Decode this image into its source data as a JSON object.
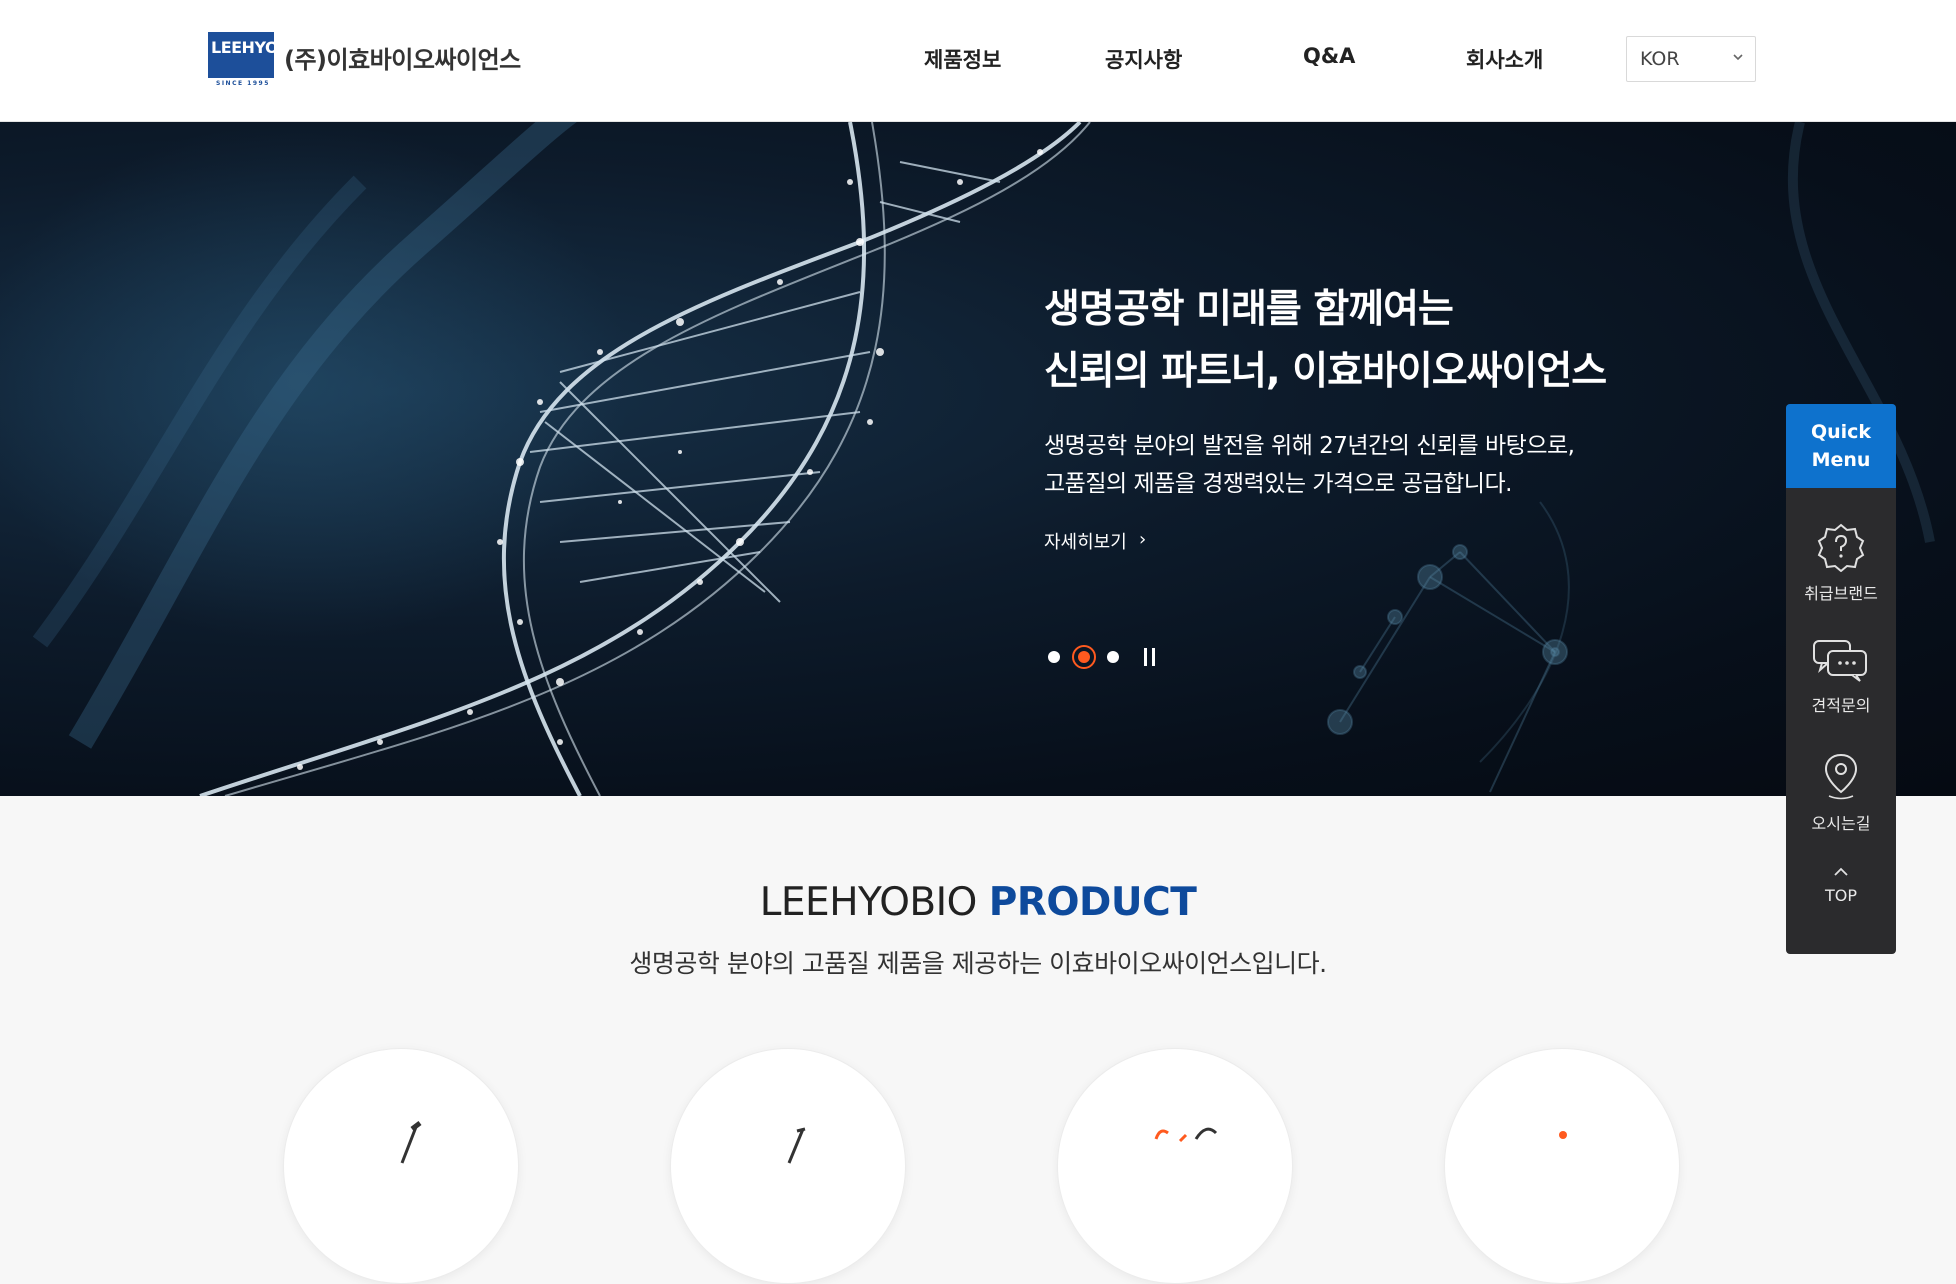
{
  "header": {
    "logo_text": "LEEHYO",
    "logo_since": "SINCE 1995",
    "company_name": "(주)이효바이오싸이언스",
    "nav": [
      "제품정보",
      "공지사항",
      "Q&A",
      "회사소개"
    ],
    "language": {
      "selected": "KOR"
    }
  },
  "hero": {
    "title_line1": "생명공학 미래를 함께여는",
    "title_line2": "신뢰의 파트너, 이효바이오싸이언스",
    "sub_line1": "생명공학 분야의 발전을 위해 27년간의 신뢰를 바탕으로,",
    "sub_line2": "고품질의 제품을 경쟁력있는 가격으로 공급합니다.",
    "more_label": "자세히보기",
    "more_arrow": "›",
    "slide_count": 3,
    "active_slide": 2
  },
  "quick_menu": {
    "title_line1": "Quick",
    "title_line2": "Menu",
    "items": [
      {
        "label": "취급브랜드",
        "icon": "badge-question-icon"
      },
      {
        "label": "견적문의",
        "icon": "chat-bubbles-icon"
      },
      {
        "label": "오시는길",
        "icon": "map-pin-icon"
      }
    ],
    "top_label": "TOP"
  },
  "product_section": {
    "title_normal": "LEEHYOBIO ",
    "title_strong": "PRODUCT",
    "subtitle": "생명공학 분야의 고품질 제품을 제공하는 이효바이오싸이언스입니다."
  },
  "colors": {
    "brand_blue": "#1d4f9a",
    "quick_blue": "#0e72cd",
    "accent_orange": "#ff5a1f",
    "product_blue": "#0e4a9c"
  }
}
